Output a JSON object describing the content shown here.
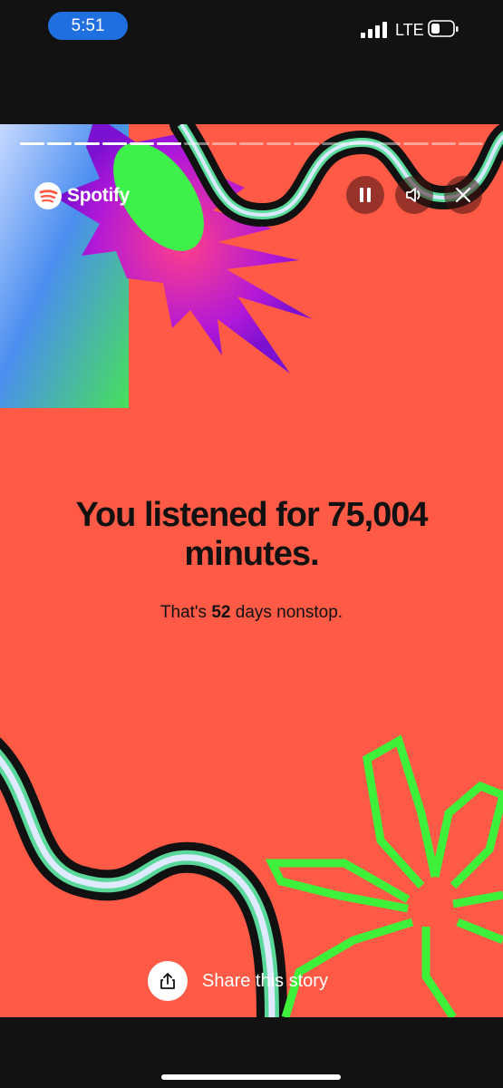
{
  "status_bar": {
    "time": "5:51",
    "carrier": "LTE"
  },
  "story": {
    "brand": "Spotify",
    "progress": {
      "segments": 17,
      "completed": 6
    },
    "headline": "You listened for 75,004 minutes.",
    "subtitle": {
      "prefix": "That's ",
      "highlight": "52",
      "suffix": " days nonstop."
    },
    "share_label": "Share this story"
  },
  "colors": {
    "background": "#ff5a45",
    "accent_green": "#3ef03a",
    "purple": "#8a1bd6"
  },
  "icons": [
    "pause-icon",
    "volume-icon",
    "close-icon",
    "share-icon",
    "spotify-logo-icon"
  ]
}
